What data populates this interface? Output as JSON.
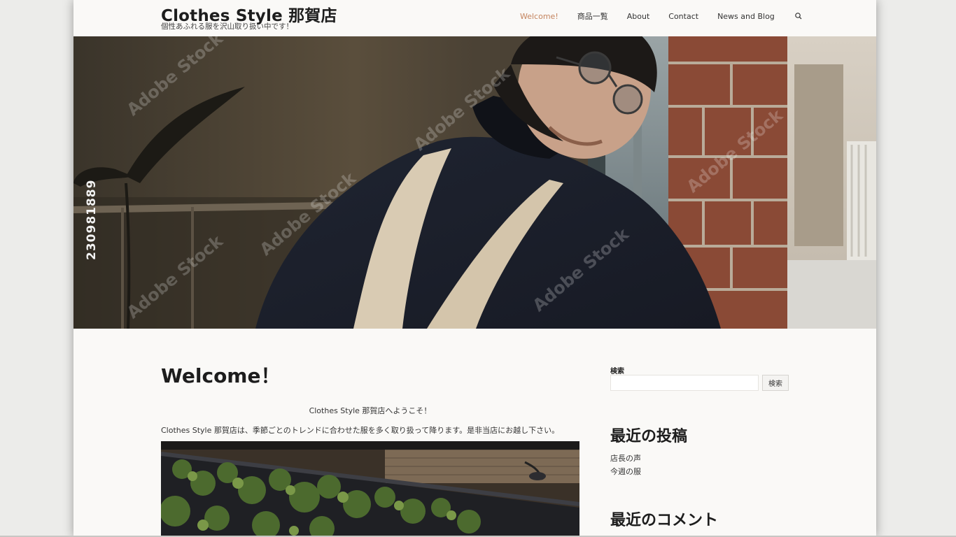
{
  "site": {
    "title": "Clothes Style 那賀店",
    "tagline": "個性あふれる服を沢山取り扱い中です！"
  },
  "nav": {
    "items": [
      {
        "label": "Welcome!",
        "active": true
      },
      {
        "label": "商品一覧",
        "active": false
      },
      {
        "label": "About",
        "active": false
      },
      {
        "label": "Contact",
        "active": false
      },
      {
        "label": "News and Blog",
        "active": false
      }
    ],
    "search_icon": "search-icon",
    "active_color": "#c4845e"
  },
  "hero": {
    "stock_id": "230981889",
    "watermark": "Adobe Stock"
  },
  "main": {
    "title": "Welcome！",
    "intro_centered": "Clothes Style 那賀店へようこそ！",
    "intro_body": "Clothes Style 那賀店は、季節ごとのトレンドに合わせた服を多く取り扱って降ります。是非当店にお越し下さい。"
  },
  "sidebar": {
    "search_label": "検索",
    "search_value": "",
    "search_button": "検索",
    "recent_posts_title": "最近の投稿",
    "recent_posts": [
      "店長の声",
      "今週の服"
    ],
    "recent_comments_title": "最近のコメント"
  }
}
